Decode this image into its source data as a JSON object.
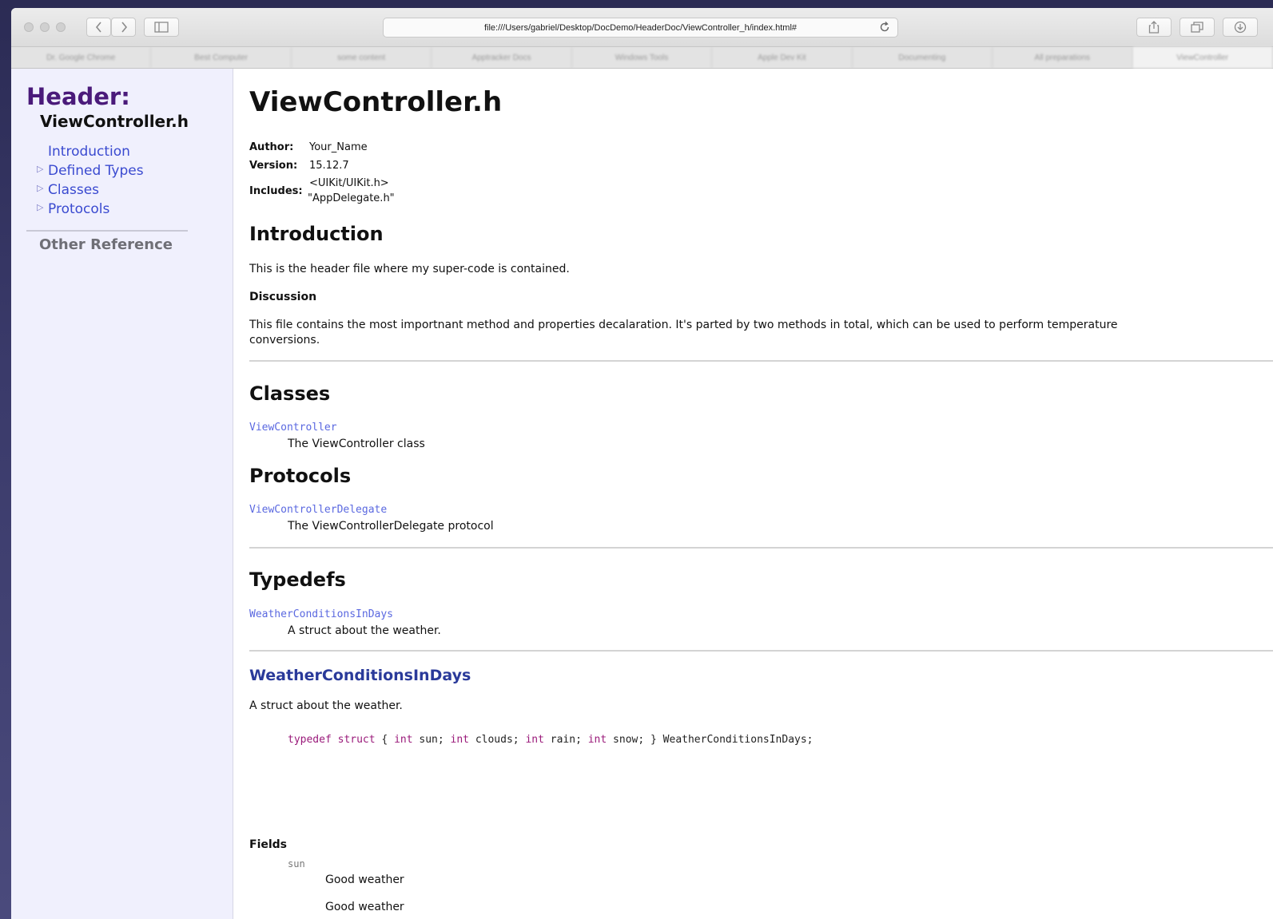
{
  "browser": {
    "url": "file:///Users/gabriel/Desktop/DocDemo/HeaderDoc/ViewController_h/index.html#",
    "bookmarks": [
      "Dr. Google Chrome",
      "Best Computer",
      "some content",
      "Apptracker Docs",
      "Windows Tools",
      "Apple Dev Kit",
      "Documenting",
      "All preparations",
      "ViewController"
    ]
  },
  "sidebar": {
    "header": "Header:",
    "file": "ViewController.h",
    "links": {
      "introduction": "Introduction",
      "defined_types": "Defined Types",
      "classes": "Classes",
      "protocols": "Protocols"
    },
    "other_reference": "Other Reference"
  },
  "doc": {
    "title": "ViewController.h",
    "meta": {
      "author_label": "Author:",
      "author": "Your_Name",
      "version_label": "Version:",
      "version": "15.12.7",
      "includes_label": "Includes:",
      "includes_1": "<UIKit/UIKit.h>",
      "includes_2": "\"AppDelegate.h\""
    },
    "introduction": {
      "heading": "Introduction",
      "text": "This is the header file where my super-code is contained.",
      "discussion_heading": "Discussion",
      "discussion": "This file contains the most importnant method and properties decalaration. It's parted by two methods in total, which can be used to perform temperature",
      "discussion_2": "conversions."
    },
    "classes": {
      "heading": "Classes",
      "link": "ViewController",
      "desc": "The ViewController class"
    },
    "protocols": {
      "heading": "Protocols",
      "link": "ViewControllerDelegate",
      "desc": "The ViewControllerDelegate protocol"
    },
    "typedefs": {
      "heading": "Typedefs",
      "link": "WeatherConditionsInDays",
      "desc": "A struct about the weather."
    },
    "struct": {
      "title": "WeatherConditionsInDays",
      "desc": "A struct about the weather.",
      "code": {
        "line1_kw": "typedef struct",
        "line1_rest": " {",
        "int_kw": "int",
        "f1": " sun;",
        "f2": " clouds;",
        "f3": " rain;",
        "f4": " snow;",
        "last": "} WeatherConditionsInDays;"
      },
      "fields_heading": "Fields",
      "field_name": "sun",
      "field_desc_1": "Good weather",
      "field_desc_2": "Good weather"
    }
  }
}
